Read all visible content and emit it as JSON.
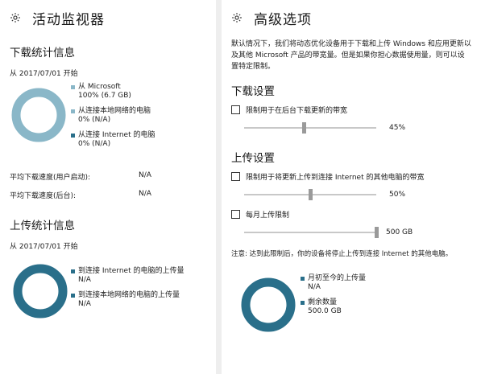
{
  "activity": {
    "title": "活动监视器",
    "download": {
      "title": "下载统计信息",
      "since": "从 2017/07/01 开始",
      "legend": [
        {
          "label": "从 Microsoft",
          "value": "100% (6.7 GB)",
          "color": "#8ab7c8"
        },
        {
          "label": "从连接本地网络的电脑",
          "value": "0% (N/A)",
          "color": "#8ab7c8"
        },
        {
          "label": "从连接 Internet 的电脑",
          "value": "0% (N/A)",
          "color": "#2a6f8a"
        }
      ],
      "avg_user_label": "平均下载速度(用户启动):",
      "avg_user_value": "N/A",
      "avg_bg_label": "平均下载速度(后台):",
      "avg_bg_value": "N/A"
    },
    "upload": {
      "title": "上传统计信息",
      "since": "从 2017/07/01 开始",
      "legend": [
        {
          "label": "到连接 Internet 的电脑的上传量",
          "value": "N/A",
          "color": "#2a6f8a"
        },
        {
          "label": "到连接本地网络的电脑的上传量",
          "value": "N/A",
          "color": "#2a6f8a"
        }
      ]
    }
  },
  "advanced": {
    "title": "高级选项",
    "description": "默认情况下，我们将动态优化设备用于下载和上传 Windows 和应用更新以及其他 Microsoft 产品的带宽量。但是如果你担心数据使用量，则可以设置特定限制。",
    "download_settings": {
      "title": "下载设置",
      "checkbox_label": "限制用于在后台下载更新的带宽",
      "slider_value_label": "45%",
      "slider_fraction": 0.45
    },
    "upload_settings": {
      "title": "上传设置",
      "checkbox_label": "限制用于将更新上传到连接 Internet 的其他电脑的带宽",
      "slider_value_label": "50%",
      "slider_fraction": 0.5,
      "monthly_label": "每月上传限制",
      "monthly_value_label": "500 GB",
      "monthly_fraction": 1.0
    },
    "note": "注意: 达到此限制后，你的设备将停止上传到连接 Internet 的其他电脑。",
    "legend": [
      {
        "label": "月初至今的上传量",
        "value": "N/A",
        "color": "#2a6f8a"
      },
      {
        "label": "剩余数量",
        "value": "500.0 GB",
        "color": "#2a6f8a"
      }
    ]
  },
  "colors": {
    "donut_download": "#8ab7c8",
    "donut_upload": "#2a6f8a"
  }
}
